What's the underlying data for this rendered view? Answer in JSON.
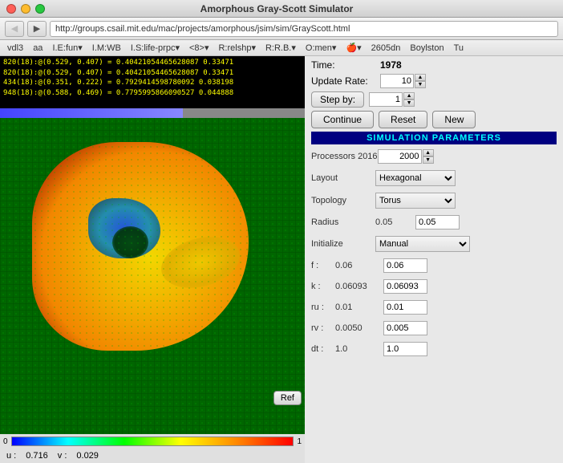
{
  "window": {
    "title": "Amorphous Gray-Scott Simulator",
    "close_btn": "●",
    "min_btn": "●",
    "max_btn": "●"
  },
  "browser": {
    "back_btn": "◀",
    "forward_btn": "▶",
    "address": "http://groups.csail.mit.edu/mac/projects/amorphous/jsim/sim/GrayScott.html"
  },
  "menubar": {
    "items": [
      "vdl3",
      "aa",
      "I.E:fun▾",
      "I.M:WB",
      "I.S:life-prpc▾",
      "<8>▾",
      "R:relshp▾",
      "R:R.B.▾",
      "O:men▾",
      "🍎▾",
      "2605dn",
      "Boylston",
      "Tu"
    ]
  },
  "simulation": {
    "log_lines": [
      "820(18):@(0.529, 0.407) = 0.40421054465628087  0.33471",
      "820(18):@(0.529, 0.407) = 0.40421054465628087  0.33471",
      "434(18):@(0.351, 0.222) = 0.7929414598780092  0.03819",
      "948(18):@(0.588, 0.469) = 0.7795995866090527  0.04488"
    ]
  },
  "controls": {
    "time_label": "Time:",
    "time_value": "1978",
    "update_rate_label": "Update Rate:",
    "update_rate_value": "10",
    "step_by_label": "Step by:",
    "step_by_value": "1",
    "continue_btn": "Continue",
    "reset_btn": "Reset",
    "new_btn": "New"
  },
  "sim_params": {
    "header": "SIMULATION PARAMETERS",
    "processors_label": "Processors 2016",
    "processors_value": "2000",
    "layout_label": "Layout",
    "layout_value": "Hexagonal",
    "topology_label": "Topology",
    "topology_value": "Torus",
    "radius_label": "Radius",
    "radius_static": "0.05",
    "radius_input": "0.05",
    "initialize_label": "Initialize",
    "initialize_value": "Manual",
    "f_label": "f :",
    "f_static": "0.06",
    "f_input": "0.06",
    "k_label": "k :",
    "k_static": "0.06093",
    "k_input": "0.06093",
    "ru_label": "ru :",
    "ru_static": "0.01",
    "ru_input": "0.01",
    "rv_label": "rv :",
    "rv_static": "0.0050",
    "rv_input": "0.005",
    "dt_label": "dt :",
    "dt_static": "1.0",
    "dt_input": "1.0"
  },
  "colorbar": {
    "min_label": "0",
    "max_label": "1"
  },
  "uv": {
    "u_label": "u :",
    "u_value": "0.716",
    "v_label": "v :",
    "v_value": "0.029"
  },
  "ref_btn": "Ref"
}
